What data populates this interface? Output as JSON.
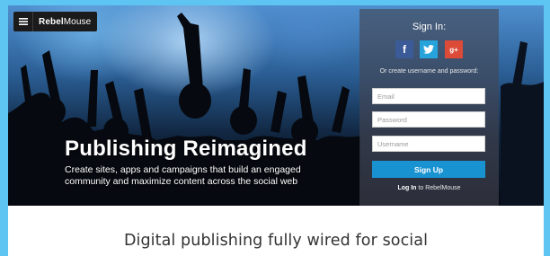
{
  "header": {
    "menu_icon": "hamburger-menu-icon",
    "brand_bold": "Rebel",
    "brand_light": "Mouse"
  },
  "hero": {
    "headline": "Publishing Reimagined",
    "subheadline": "Create sites, apps and campaigns that build an engaged community and maximize content across the social web"
  },
  "signin": {
    "title": "Sign In:",
    "social_icons": [
      "facebook-icon",
      "twitter-icon",
      "google-plus-icon"
    ],
    "facebook_glyph": "f",
    "google_glyph": "g+",
    "hint": "Or create username and password:",
    "email_placeholder": "Email",
    "password_placeholder": "Password",
    "username_placeholder": "Username",
    "signup_label": "Sign Up",
    "login_link": "Log In",
    "login_suffix": "to RebelMouse"
  },
  "main": {
    "tagline": "Digital publishing fully wired for social"
  },
  "colors": {
    "page_background": "#5ec4f2",
    "facebook": "#3b5a98",
    "twitter": "#26a3da",
    "google_plus": "#dc4a38",
    "signup_button": "#1992d2"
  }
}
